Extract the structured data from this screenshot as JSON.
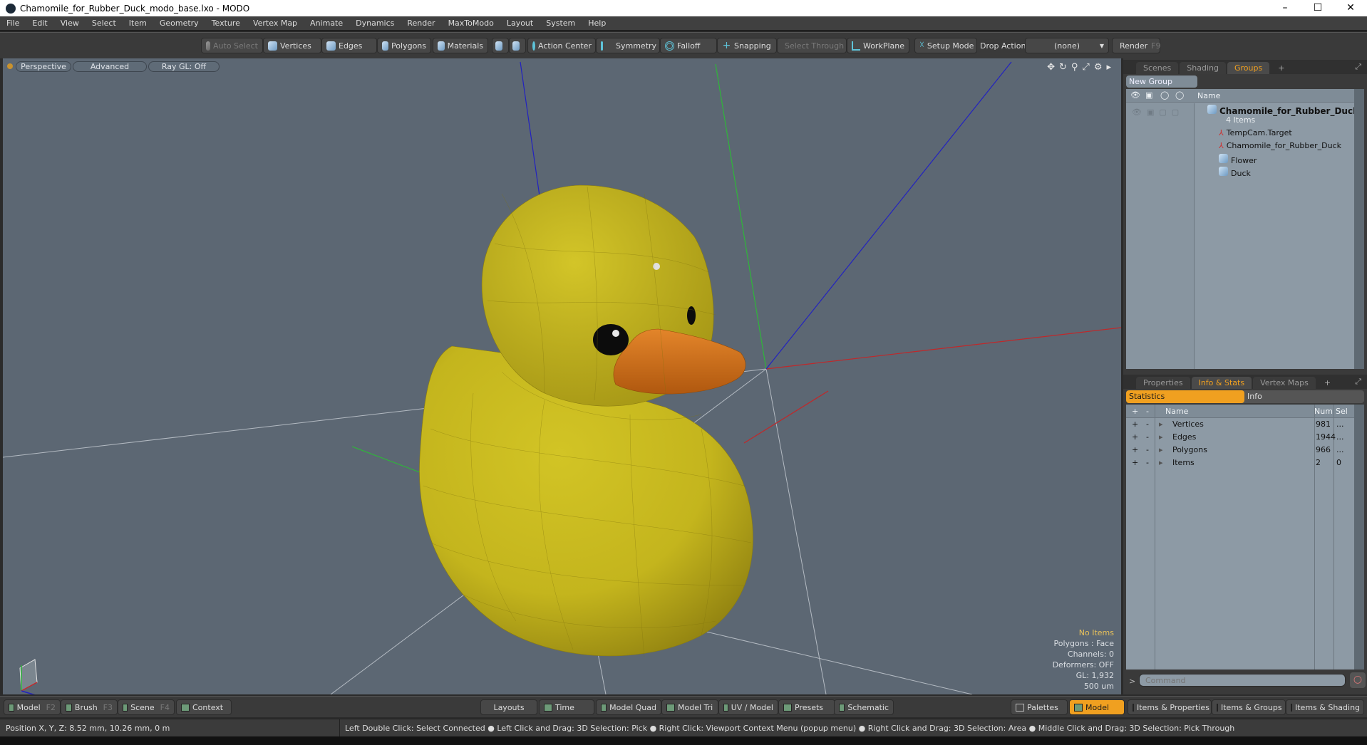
{
  "window": {
    "title": "Chamomile_for_Rubber_Duck_modo_base.lxo - MODO",
    "minimize": "–",
    "maximize": "☐",
    "close": "✕"
  },
  "menu": [
    "File",
    "Edit",
    "View",
    "Select",
    "Item",
    "Geometry",
    "Texture",
    "Vertex Map",
    "Animate",
    "Dynamics",
    "Render",
    "MaxToModo",
    "Layout",
    "System",
    "Help"
  ],
  "toolbar": {
    "auto_select": "Auto Select",
    "vertices": "Vertices",
    "edges": "Edges",
    "polygons": "Polygons",
    "materials": "Materials",
    "action_center": "Action Center",
    "symmetry": "Symmetry",
    "falloff": "Falloff",
    "snapping": "Snapping",
    "select_through": "Select Through",
    "workplane": "WorkPlane",
    "setup_mode": "Setup Mode",
    "drop_action_label": "Drop Action",
    "drop_action_value": "(none)",
    "render": "Render",
    "render_key": "F9"
  },
  "viewport": {
    "view_mode": "Perspective",
    "shading": "Advanced",
    "raygl": "Ray GL: Off",
    "info": {
      "selection": "No Items",
      "polygons": "Polygons : Face",
      "channels": "Channels: 0",
      "deformers": "Deformers: OFF",
      "gl": "GL: 1,932",
      "scale": "500 um"
    },
    "colors": {
      "background": "#5c6773",
      "duck": "#c8b91c",
      "beak": "#d9761e"
    }
  },
  "groups_panel": {
    "tabs": [
      "Scenes",
      "Shading",
      "Groups"
    ],
    "active_tab": "Groups",
    "new_group": "New Group",
    "column_name": "Name",
    "group": {
      "name": "Chamomile_for_Rubber_Duck",
      "suffix": "( ...",
      "count": "4 Items"
    },
    "items": [
      {
        "name": "TempCam.Target",
        "icon": "locator-icon"
      },
      {
        "name": "Chamomile_for_Rubber_Duck",
        "icon": "locator-icon"
      },
      {
        "name": "Flower",
        "icon": "mesh-icon"
      },
      {
        "name": "Duck",
        "icon": "mesh-icon"
      }
    ]
  },
  "stats_panel": {
    "tabs": [
      "Properties",
      "Info & Stats",
      "Vertex Maps"
    ],
    "active_tab": "Info & Stats",
    "subtabs": [
      "Statistics",
      "Info"
    ],
    "headers": {
      "plus": "+",
      "minus": "-",
      "name": "Name",
      "num": "Num",
      "sel": "Sel"
    },
    "rows": [
      {
        "name": "Vertices",
        "num": "981",
        "sel": "..."
      },
      {
        "name": "Edges",
        "num": "1944",
        "sel": "..."
      },
      {
        "name": "Polygons",
        "num": "966",
        "sel": "..."
      },
      {
        "name": "Items",
        "num": "2",
        "sel": "0"
      }
    ],
    "command_placeholder": "Command",
    "prompt": ">"
  },
  "bottom_tabs": {
    "left": [
      {
        "label": "Model",
        "key": "F2"
      },
      {
        "label": "Brush",
        "key": "F3"
      },
      {
        "label": "Scene",
        "key": "F4"
      },
      {
        "label": "Context",
        "key": ""
      }
    ],
    "center": [
      "Layouts",
      "Time",
      "Model Quad",
      "Model Tri",
      "UV / Model",
      "Presets",
      "Schematic"
    ],
    "right": [
      "Palettes",
      "Model",
      "Items & Properties",
      "Items & Groups",
      "Items & Shading"
    ],
    "active": "Model"
  },
  "status": {
    "position": "Position X, Y, Z:   8.52 mm, 10.26 mm, 0 m",
    "hints": "Left Double Click: Select Connected ● Left Click and Drag: 3D Selection: Pick ● Right Click: Viewport Context Menu (popup menu) ● Right Click and Drag: 3D Selection: Area ● Middle Click and Drag: 3D Selection: Pick Through"
  }
}
